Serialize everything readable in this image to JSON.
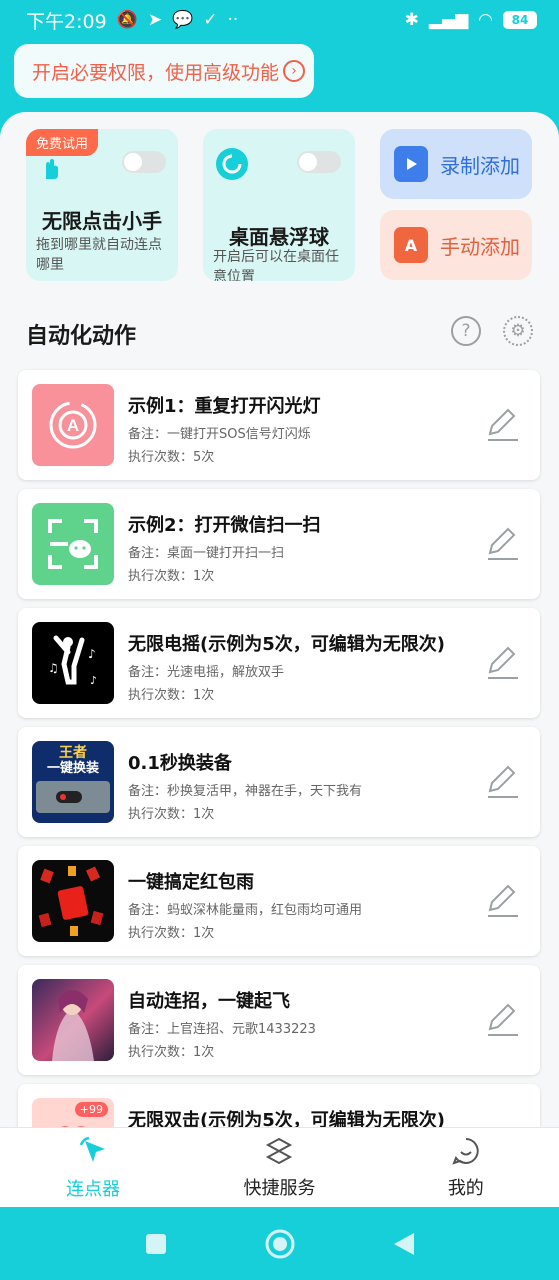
{
  "status_bar": {
    "time": "下午2:09",
    "battery": "84"
  },
  "permission_banner": {
    "text": "开启必要权限，使用高级功能"
  },
  "cards": {
    "clicker": {
      "badge": "免费试用",
      "title": "无限点击小手",
      "subtitle": "拖到哪里就自动连点哪里"
    },
    "float_ball": {
      "title": "桌面悬浮球",
      "subtitle": "开启后可以在桌面任意位置"
    },
    "record_add": "录制添加",
    "manual_add": "手动添加"
  },
  "section": {
    "title": "自动化动作"
  },
  "actions": [
    {
      "name": "示例1：重复打开闪光灯",
      "note": "备注：一键打开SOS信号灯闪烁",
      "count": "执行次数：5次"
    },
    {
      "name": "示例2：打开微信扫一扫",
      "note": "备注：桌面一键打开扫一扫",
      "count": "执行次数：1次"
    },
    {
      "name": "无限电摇(示例为5次，可编辑为无限次)",
      "note": "备注：光速电摇，解放双手",
      "count": "执行次数：1次"
    },
    {
      "name": "0.1秒换装备",
      "note": "备注：秒换复活甲，神器在手，天下我有",
      "count": "执行次数：1次"
    },
    {
      "name": "一键搞定红包雨",
      "note": "备注：蚂蚁深林能量雨，红包雨均可通用",
      "count": "执行次数：1次"
    },
    {
      "name": "自动连招，一键起飞",
      "note": "备注：上官连招、元歌1433223",
      "count": "执行次数：1次"
    },
    {
      "name": "无限双击(示例为5次，可编辑为无限次)",
      "note": "",
      "count": ""
    }
  ],
  "thumb_text": {
    "item4_line1": "王者",
    "item4_line2": "一键换装",
    "item7_badge": "+99"
  },
  "bottom_nav": [
    {
      "label": "连点器"
    },
    {
      "label": "快捷服务"
    },
    {
      "label": "我的"
    }
  ],
  "colors": {
    "accent": "#16cfd9",
    "card_bg": "#d8f6f4",
    "badge": "#ff6a4a",
    "record_btn_bg": "#cfe0fb",
    "manual_btn_bg": "#fde4dc"
  }
}
